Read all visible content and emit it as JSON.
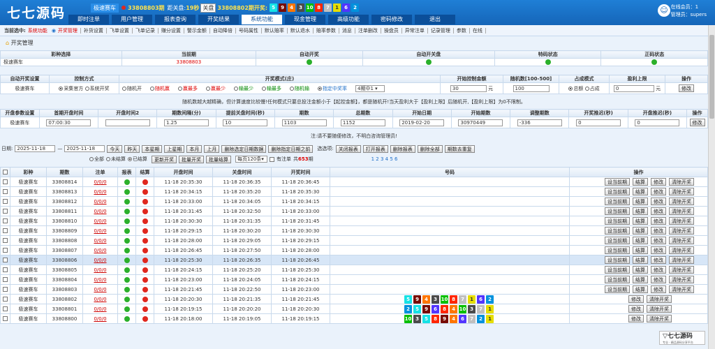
{
  "header": {
    "logo": "七七源码",
    "game": "极速赛车",
    "cur_issue": "33808803期",
    "countdown_label": "距关盘:",
    "countdown": "19秒",
    "close_btn": "关盘",
    "last_issue": "33808802期开奖:",
    "last_balls": [
      "5",
      "9",
      "4",
      "3",
      "10",
      "8",
      "7",
      "1",
      "6",
      "2"
    ],
    "user_online": "在线会员：1",
    "user_admin": "管理员：supers"
  },
  "nav": [
    "即时注单",
    "用户管理",
    "报表查询",
    "开奖结果",
    "系统功能",
    "现金管理",
    "高级功能",
    "密码修改",
    "退出"
  ],
  "subnav": {
    "current_label": "当前选中:",
    "current_value": "系统功能",
    "items": [
      "开奖管理",
      "补货设置",
      "飞单设置",
      "飞单记录",
      "赚分设置",
      "警示金额",
      "自动降倍",
      "号码属性",
      "默认赔率",
      "默认退水",
      "赔率参数",
      "消息",
      "注单删改",
      "操盘员",
      "异常注单",
      "记录管理",
      "参数",
      "在线"
    ]
  },
  "crumb": "开奖管理",
  "t1": {
    "headers": [
      "彩种选择",
      "当前期",
      "自动开奖",
      "自动开关盘",
      "特码状态",
      "正码状态"
    ],
    "game": "极速赛车",
    "issue": "33808803"
  },
  "t2": {
    "headers": [
      "自动开奖设置",
      "控制方式",
      "开奖模式(庄)",
      "开始控制金额",
      "随机数[100-500]",
      "占成模式",
      "盈利上限",
      "操作"
    ],
    "game": "极速赛车",
    "ctrl": [
      "采集官方",
      "系统开奖"
    ],
    "modes": [
      "随机开",
      "随机赢",
      "赢最多",
      "赢最少",
      "输最少",
      "输最多",
      "随机输",
      "指定中奖率"
    ],
    "rate": "4期中1",
    "amount": "30",
    "amount_unit": "元",
    "rnd": "100",
    "share": [
      "总额",
      "占成"
    ],
    "limit": "0",
    "limit_unit": "元",
    "edit": "修改",
    "note": "随机数越大越精确，但计算速度比较慢!任何模式只要总投注金额小于【起控金额】，都是随机开!当天盈利大于【盈利上限】后随机开,【盈利上限】为0不限制。"
  },
  "t3": {
    "headers": [
      "开盘参数设置",
      "首期开盘时间",
      "开盘时间2",
      "期数间隔(分)",
      "提前关盘时间(秒)",
      "期数",
      "总期数",
      "开始日期",
      "开始期数",
      "调整期数",
      "开奖推迟(秒)",
      "开盘推迟(秒)",
      "操作"
    ],
    "values": [
      "极速赛车",
      "07:00:30",
      "",
      "1.25",
      "10",
      "1103",
      "1152",
      "2019-02-20",
      "30970449",
      "-336",
      "0",
      "0"
    ],
    "edit": "修改",
    "note": "注:请不要随便修改，不明白咨询管理员!"
  },
  "filter": {
    "date_label": "日期:",
    "from": "2025-11-18",
    "to": "2025-11-18",
    "btns": [
      "今天",
      "昨天",
      "本星期",
      "上星期",
      "本月",
      "上月",
      "删除选定日期数据",
      "删除指定日期之前"
    ],
    "opt_label": "选选项:",
    "btns2": [
      "关闭报表",
      "打开报表",
      "删除报表",
      "删除全部",
      "期数去重复"
    ],
    "radios": [
      "全部",
      "未结算",
      "已结算"
    ],
    "btns3": [
      "更新开奖",
      "批量开奖",
      "批量结算"
    ],
    "perpage": "每页120条",
    "has_mark": "有注单",
    "total_pre": "共",
    "total": "653",
    "total_suf": "期",
    "pages": "1 2 3 4 5 6"
  },
  "list": {
    "headers": [
      "",
      "彩种",
      "期数",
      "注单",
      "报表",
      "结算",
      "开盘时间",
      "关盘时间",
      "开奖时间",
      "号码",
      "操作"
    ],
    "btns": [
      "设当前期",
      "结算",
      "修改",
      "清除开奖"
    ],
    "rows": [
      [
        "极速赛车",
        "33808814",
        "0/0/0",
        "g",
        "r",
        "11-18 20:35:30",
        "11-18 20:36:35",
        "11-18 20:36:45"
      ],
      [
        "极速赛车",
        "33808813",
        "0/0/0",
        "g",
        "r",
        "11-18 20:34:15",
        "11-18 20:35:20",
        "11-18 20:35:30"
      ],
      [
        "极速赛车",
        "33808812",
        "0/0/0",
        "g",
        "r",
        "11-18 20:33:00",
        "11-18 20:34:05",
        "11-18 20:34:15"
      ],
      [
        "极速赛车",
        "33808811",
        "0/0/0",
        "g",
        "r",
        "11-18 20:31:45",
        "11-18 20:32:50",
        "11-18 20:33:00"
      ],
      [
        "极速赛车",
        "33808810",
        "0/0/0",
        "g",
        "r",
        "11-18 20:30:30",
        "11-18 20:31:35",
        "11-18 20:31:45"
      ],
      [
        "极速赛车",
        "33808809",
        "0/0/0",
        "g",
        "r",
        "11-18 20:29:15",
        "11-18 20:30:20",
        "11-18 20:30:30"
      ],
      [
        "极速赛车",
        "33808808",
        "0/0/0",
        "g",
        "r",
        "11-18 20:28:00",
        "11-18 20:29:05",
        "11-18 20:29:15"
      ],
      [
        "极速赛车",
        "33808807",
        "0/0/0",
        "g",
        "r",
        "11-18 20:26:45",
        "11-18 20:27:50",
        "11-18 20:28:00"
      ],
      [
        "极速赛车",
        "33808806",
        "0/0/0",
        "g",
        "r",
        "11-18 20:25:30",
        "11-18 20:26:35",
        "11-18 20:26:45"
      ],
      [
        "极速赛车",
        "33808805",
        "0/0/0",
        "g",
        "r",
        "11-18 20:24:15",
        "11-18 20:25:20",
        "11-18 20:25:30"
      ],
      [
        "极速赛车",
        "33808804",
        "0/0/0",
        "g",
        "r",
        "11-18 20:23:00",
        "11-18 20:24:05",
        "11-18 20:24:15"
      ],
      [
        "极速赛车",
        "33808803",
        "0/0/0",
        "g",
        "r",
        "11-18 20:21:45",
        "11-18 20:22:50",
        "11-18 20:23:00"
      ],
      [
        "极速赛车",
        "33808802",
        "0/0/0",
        "g",
        "r",
        "11-18 20:20:30",
        "11-18 20:21:35",
        "11-18 20:21:45"
      ],
      [
        "极速赛车",
        "33808801",
        "0/0/0",
        "g",
        "r",
        "11-18 20:19:15",
        "11-18 20:20:20",
        "11-18 20:20:30"
      ],
      [
        "极速赛车",
        "33808800",
        "0/0/0",
        "g",
        "r",
        "11-18 20:18:00",
        "11-18 20:19:05",
        "11-18 20:19:15"
      ]
    ],
    "balls": {
      "12": [
        "5",
        "9",
        "4",
        "3",
        "10",
        "8",
        "7",
        "1",
        "6",
        "2"
      ],
      "13": [
        "2",
        "5",
        "9",
        "6",
        "8",
        "4",
        "10",
        "3",
        "7",
        "1"
      ],
      "14": [
        "10",
        "3",
        "5",
        "8",
        "9",
        "4",
        "6",
        "7",
        "2",
        "1"
      ]
    }
  },
  "ball_colors": {
    "1": "#e6de00",
    "2": "#0092dd",
    "3": "#4b4b4b",
    "4": "#ff7600",
    "5": "#17e2e5",
    "6": "#5234ff",
    "7": "#bfbfbf",
    "8": "#ff2600",
    "9": "#780b00",
    "10": "#07bf00"
  },
  "watermark": {
    "name": "七七源码",
    "tag": "专业 · 精品源码分享平台"
  }
}
